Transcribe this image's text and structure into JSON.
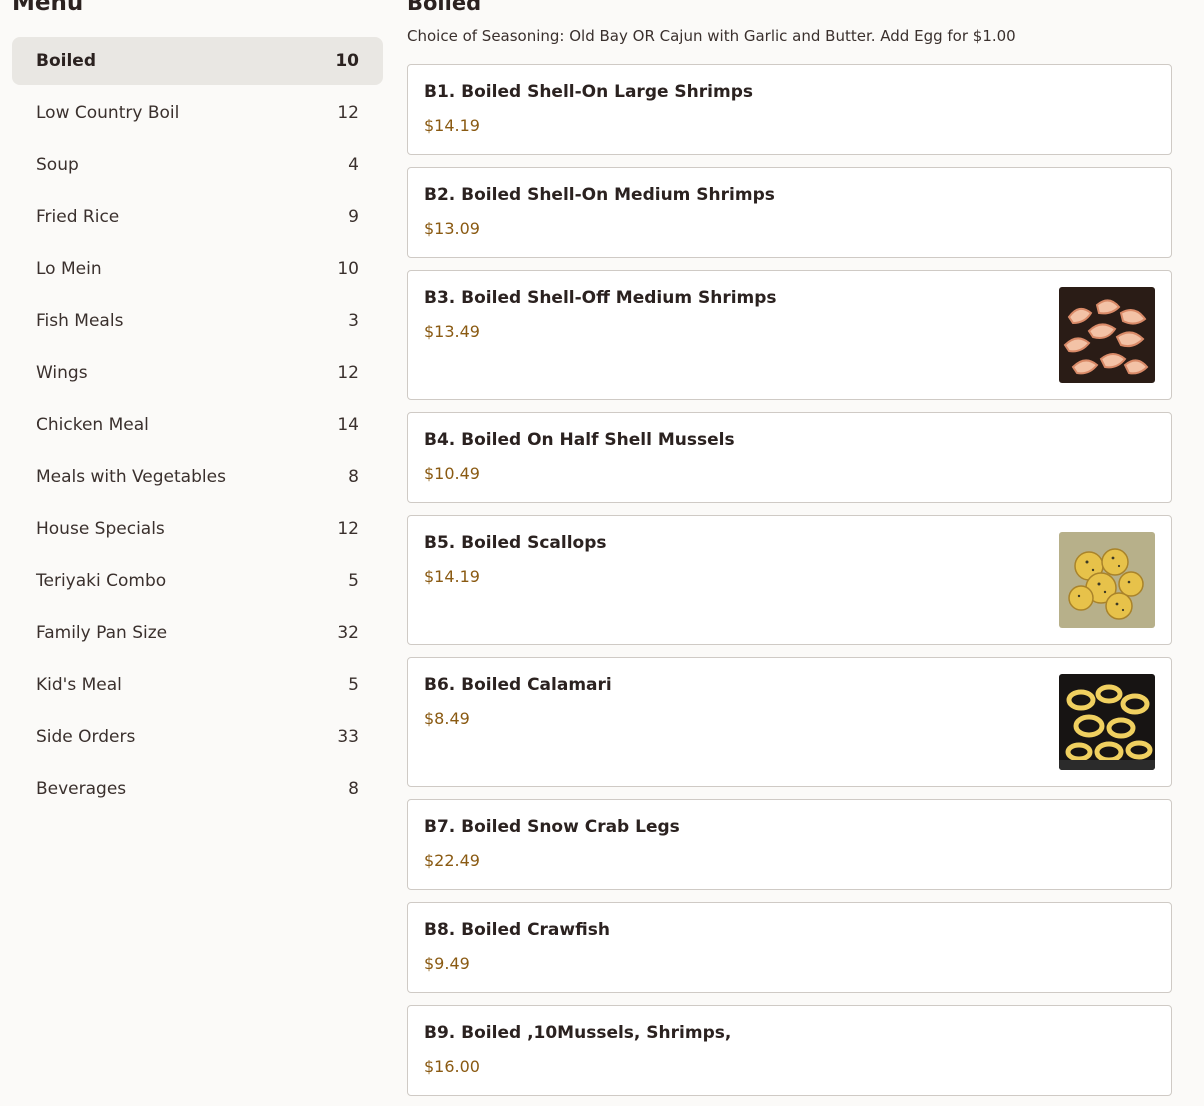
{
  "sidebar": {
    "title": "Menu",
    "items": [
      {
        "label": "Boiled",
        "count": "10"
      },
      {
        "label": "Low Country Boil",
        "count": "12"
      },
      {
        "label": "Soup",
        "count": "4"
      },
      {
        "label": "Fried Rice",
        "count": "9"
      },
      {
        "label": "Lo Mein",
        "count": "10"
      },
      {
        "label": "Fish Meals",
        "count": "3"
      },
      {
        "label": "Wings",
        "count": "12"
      },
      {
        "label": "Chicken Meal",
        "count": "14"
      },
      {
        "label": "Meals with Vegetables",
        "count": "8"
      },
      {
        "label": "House Specials",
        "count": "12"
      },
      {
        "label": "Teriyaki Combo",
        "count": "5"
      },
      {
        "label": "Family Pan Size",
        "count": "32"
      },
      {
        "label": "Kid's Meal",
        "count": "5"
      },
      {
        "label": "Side Orders",
        "count": "33"
      },
      {
        "label": "Beverages",
        "count": "8"
      }
    ]
  },
  "section": {
    "title": "Boiled",
    "description": "Choice of Seasoning: Old Bay OR Cajun with Garlic and Butter. Add Egg for $1.00"
  },
  "items": [
    {
      "name": "B1. Boiled Shell-On Large Shrimps",
      "price": "$14.19"
    },
    {
      "name": "B2. Boiled Shell-On Medium Shrimps",
      "price": "$13.09"
    },
    {
      "name": "B3. Boiled Shell-Off Medium Shrimps",
      "price": "$13.49",
      "image": "shrimp-photo"
    },
    {
      "name": "B4. Boiled On Half Shell Mussels",
      "price": "$10.49"
    },
    {
      "name": "B5. Boiled Scallops",
      "price": "$14.19",
      "image": "scallops-photo"
    },
    {
      "name": "B6. Boiled Calamari",
      "price": "$8.49",
      "image": "calamari-photo"
    },
    {
      "name": "B7. Boiled Snow Crab Legs",
      "price": "$22.49"
    },
    {
      "name": "B8. Boiled Crawfish",
      "price": "$9.49"
    },
    {
      "name": "B9. Boiled ,10Mussels, Shrimps,",
      "price": "$16.00"
    }
  ],
  "colors": {
    "active_bg": "#e9e7e3",
    "price": "#8a5a12",
    "border": "#cfcac5"
  }
}
